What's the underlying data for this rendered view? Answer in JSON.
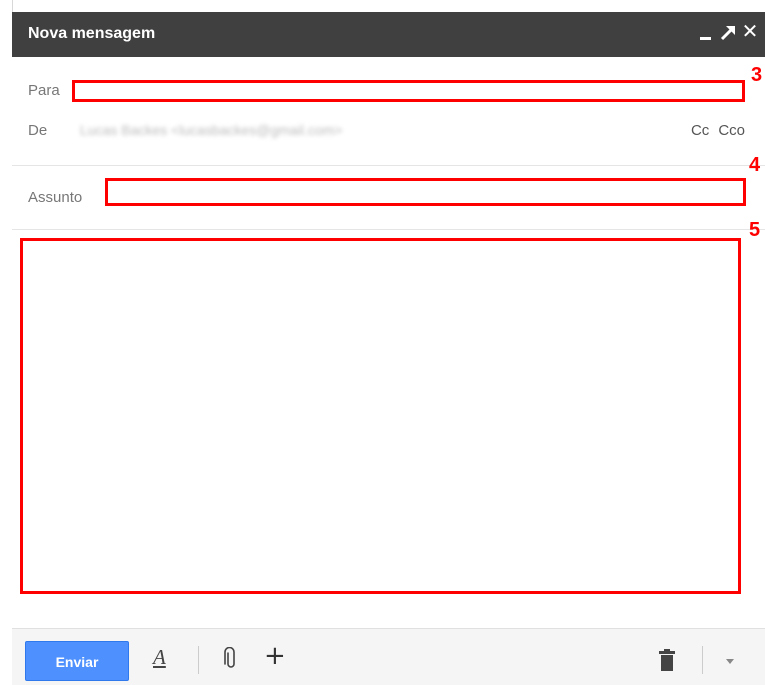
{
  "window": {
    "title": "Nova mensagem"
  },
  "fields": {
    "to_label": "Para",
    "from_label": "De",
    "from_value": "Lucas Backes <lucasbackes@gmail.com>",
    "cc_label": "Cc",
    "bcc_label": "Cco",
    "subject_label": "Assunto"
  },
  "annotations": [
    "3",
    "4",
    "5"
  ],
  "footer": {
    "send_label": "Enviar"
  },
  "icons": {
    "minimize": "minimize-icon",
    "popout": "popout-icon",
    "close": "close-icon",
    "formatting": "text-formatting-icon",
    "attach": "paperclip-icon",
    "more_options": "plus-icon",
    "discard": "trash-icon",
    "menu": "chevron-down-icon"
  },
  "colors": {
    "titlebar": "#404040",
    "send_button": "#4d90fe",
    "annotation": "#ff0000"
  }
}
